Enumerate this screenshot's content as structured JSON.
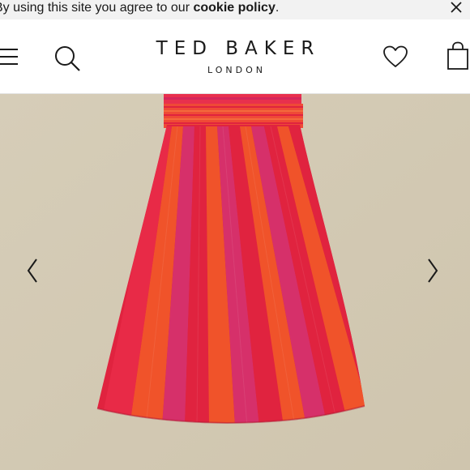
{
  "cookie": {
    "text_prefix": "By using this site you agree to our ",
    "link_text": "cookie policy",
    "text_suffix": "."
  },
  "brand": {
    "name": "TED BAKER",
    "subtitle": "LONDON"
  },
  "icons": {
    "close": "close-icon",
    "menu": "hamburger-menu-icon",
    "search": "search-icon",
    "wishlist": "heart-icon",
    "bag": "shopping-bag-icon",
    "prev": "chevron-left-icon",
    "next": "chevron-right-icon"
  },
  "colors": {
    "background": "#d8cfbb",
    "skirt_red": "#e0233f",
    "skirt_orange": "#f0532a",
    "skirt_pink": "#d6306a",
    "waistband": "#ef4a36"
  }
}
